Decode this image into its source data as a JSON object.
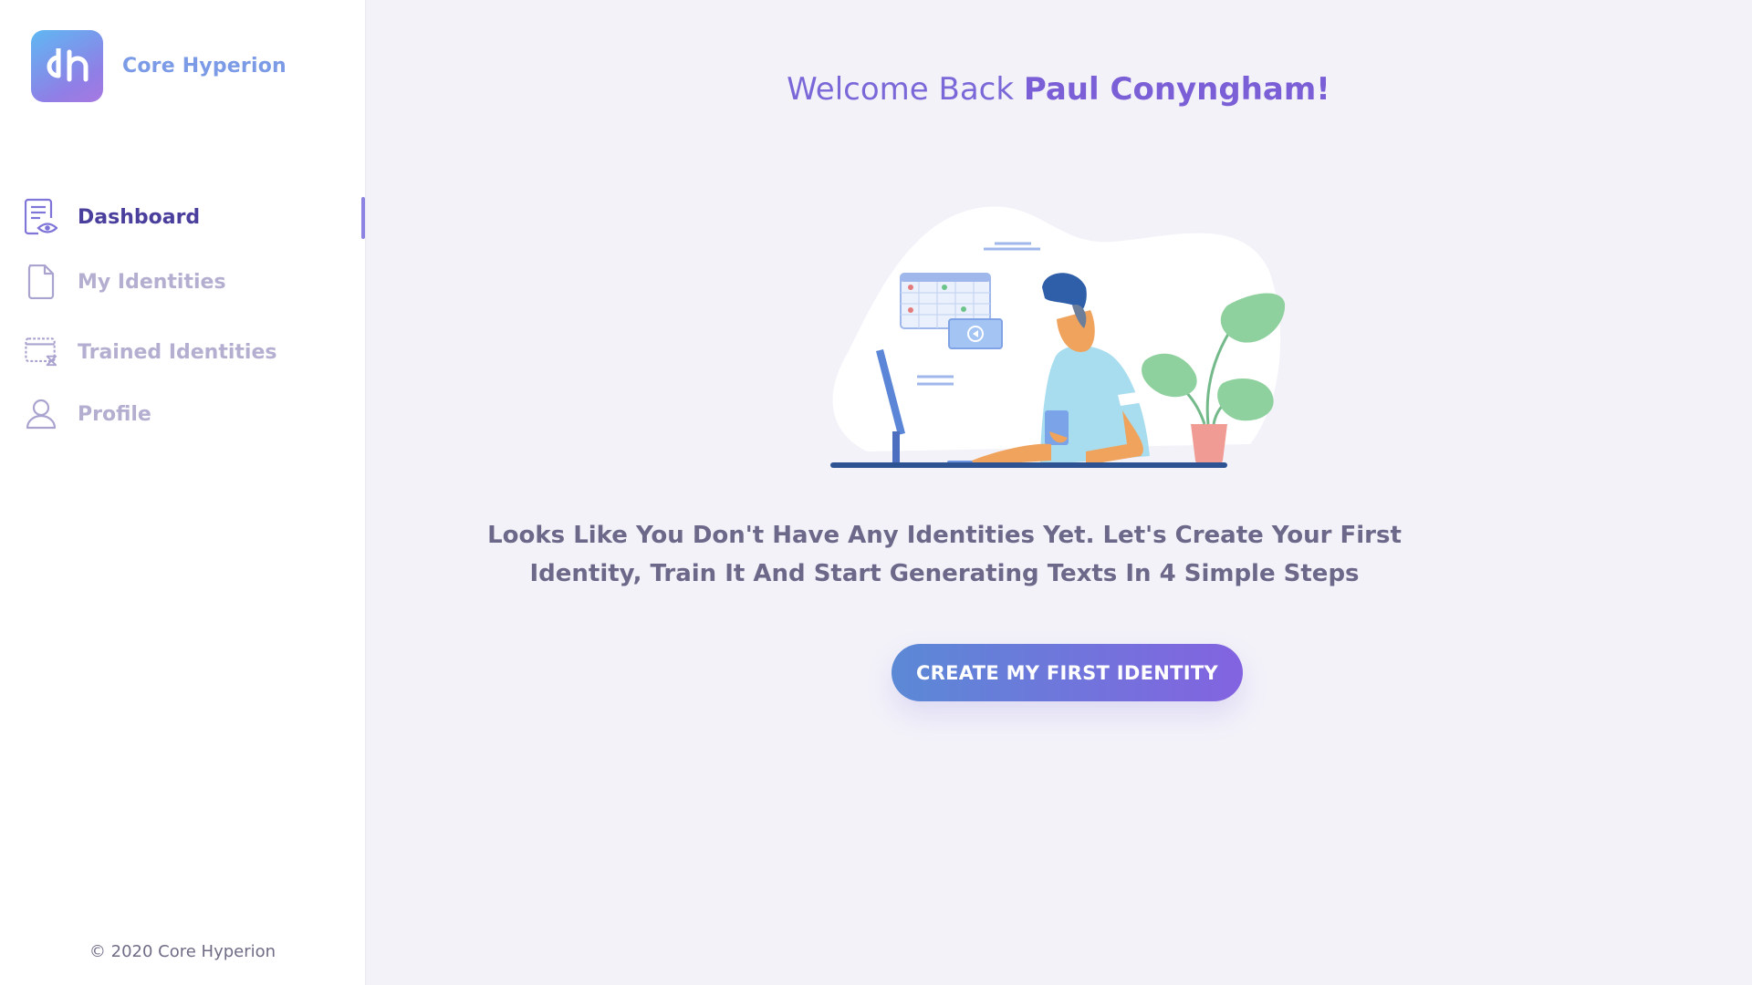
{
  "app": {
    "name": "Core Hyperion",
    "logo_glyph": "dh",
    "accent": "#7b68d8"
  },
  "sidebar": {
    "items": [
      {
        "label": "Dashboard",
        "icon": "dashboard-document-eye-icon",
        "active": true
      },
      {
        "label": "My Identities",
        "icon": "file-icon",
        "active": false
      },
      {
        "label": "Trained Identities",
        "icon": "training-window-icon",
        "active": false
      },
      {
        "label": "Profile",
        "icon": "user-icon",
        "active": false
      }
    ],
    "footer": "© 2020 Core Hyperion"
  },
  "main": {
    "welcome_prefix": "Welcome Back",
    "welcome_name": "Paul Conyngham!",
    "message": "Looks Like You Don't Have Any Identities Yet. Let's Create Your First Identity, Train It And Start Generating Texts In 4 Simple Steps",
    "cta_label": "CREATE MY FIRST IDENTITY"
  }
}
